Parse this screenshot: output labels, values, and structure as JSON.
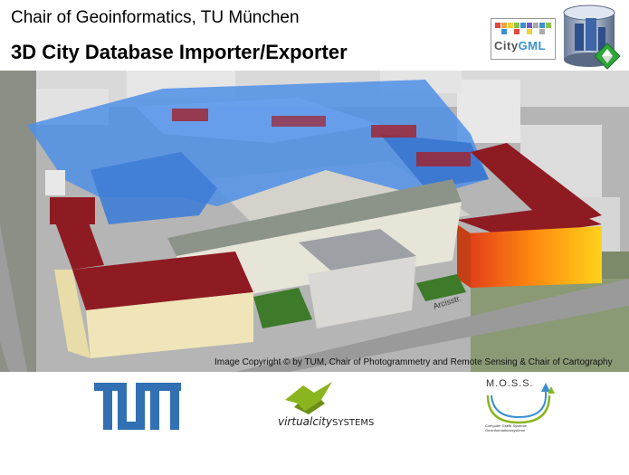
{
  "header": {
    "line1": "Chair of Geoinformatics, TU München",
    "line2": "3D City Database Importer/Exporter",
    "citygml_logo": {
      "prefix": "City",
      "suffix": "GML"
    }
  },
  "image": {
    "street_label": "Arcisstr.",
    "copyright": "Image Copyright © by TUM, Chair of Photogrammetry and Remote Sensing & Chair of Cartography"
  },
  "footer": {
    "vcs": {
      "prefix": "virtualcity",
      "suffix": "SYSTEMS"
    },
    "moss": {
      "name": "M.O.S.S.",
      "line1": "Computer Grafik Systeme",
      "line2": "Geoinformationssysteme"
    }
  },
  "colors": {
    "brand_blue": "#3070b3",
    "citygml_blue": "#3a8fd0",
    "vcs_green": "#8bb51e"
  }
}
